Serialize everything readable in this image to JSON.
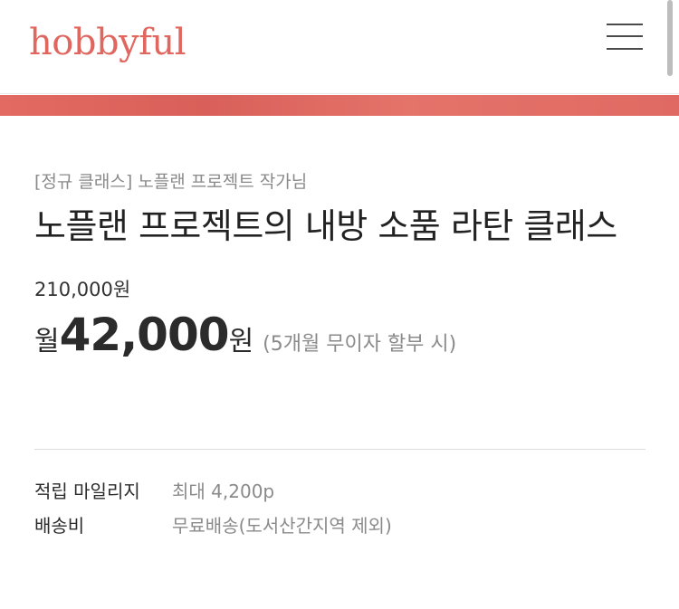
{
  "header": {
    "logo": "hobbyful",
    "menu_icon": "hamburger-icon"
  },
  "product": {
    "label": "[정규 클래스] 노플랜 프로젝트 작가님",
    "title": "노플랜 프로젝트의 내방 소품 라탄 클래스",
    "original_price": "210,000원",
    "monthly_prefix": "월",
    "monthly_amount": "42,000",
    "monthly_suffix": "원",
    "installment_note": "(5개월 무이자 할부 시)"
  },
  "info": [
    {
      "key": "적립 마일리지",
      "value": "최대 4,200p"
    },
    {
      "key": "배송비",
      "value": "무료배송(도서산간지역 제외)"
    }
  ],
  "colors": {
    "brand": "#e0675f",
    "text": "#2b2b2b",
    "muted": "#8a8a8a"
  }
}
